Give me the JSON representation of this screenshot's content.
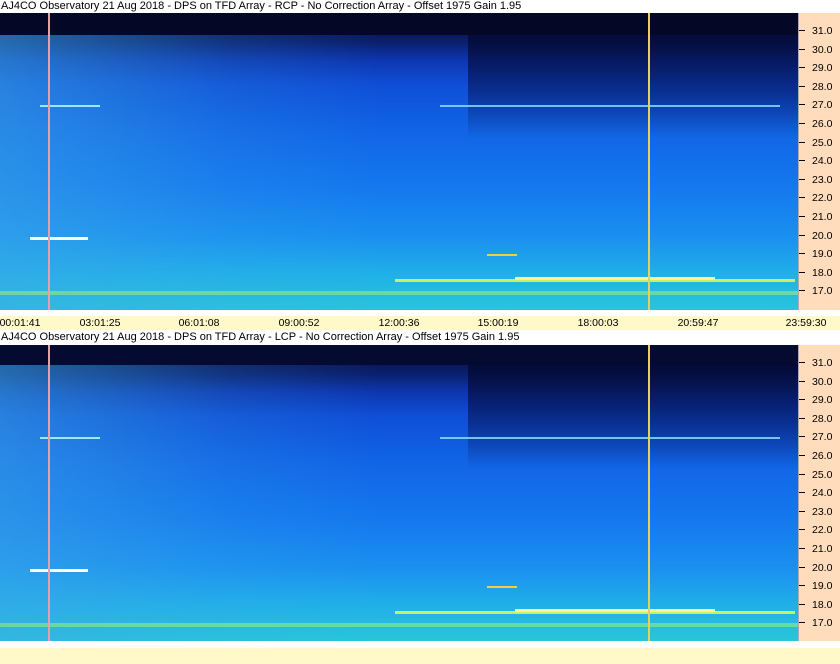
{
  "panels": [
    {
      "title": "AJ4CO Observatory 21 Aug 2018 - DPS on TFD Array   - RCP  -  No Correction Array  -  Offset 1975  Gain 1.95",
      "y_labels": [
        "31.0",
        "30.0",
        "29.0",
        "28.0",
        "27.0",
        "26.0",
        "25.0",
        "24.0",
        "23.0",
        "22.0",
        "21.0",
        "20.0",
        "19.0",
        "18.0",
        "17.0"
      ],
      "x_labels": [
        "00:01:41",
        "03:01:25",
        "06:01:08",
        "09:00:52",
        "12:00:36",
        "15:00:19",
        "18:00:03",
        "20:59:47",
        "23:59:30"
      ]
    },
    {
      "title": "AJ4CO Observatory 21 Aug 2018 - DPS on TFD Array   - LCP  -  No Correction Array  -  Offset 1975  Gain 1.95",
      "y_labels": [
        "31.0",
        "30.0",
        "29.0",
        "28.0",
        "27.0",
        "26.0",
        "25.0",
        "24.0",
        "23.0",
        "22.0",
        "21.0",
        "20.0",
        "19.0",
        "18.0",
        "17.0"
      ],
      "x_labels": []
    }
  ],
  "colors": {
    "axis_bg": "#ffdcbc",
    "time_axis_bg": "#fff8c8",
    "marker_left": "#e8a0a8",
    "marker_right": "#e8d060"
  }
}
